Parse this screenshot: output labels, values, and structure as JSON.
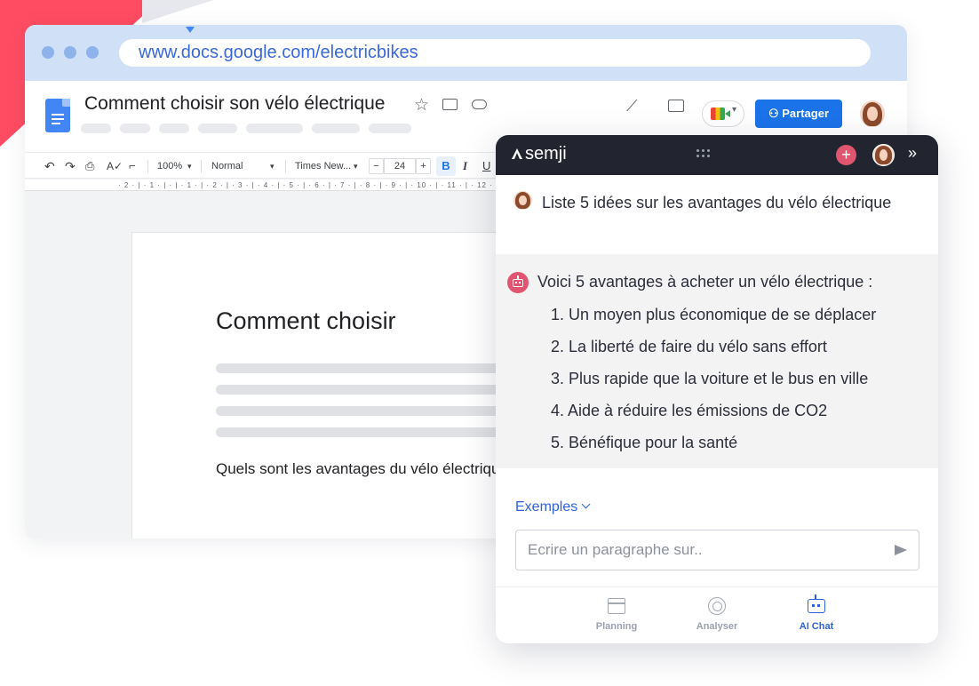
{
  "browser": {
    "url": "www.docs.google.com/electricbikes"
  },
  "docs": {
    "title": "Comment choisir son vélo électrique",
    "share_label": "Partager",
    "toolbar": {
      "zoom": "100%",
      "style": "Normal",
      "font": "Times New...",
      "font_size": "24",
      "bold": "B",
      "italic": "I",
      "underline": "U"
    },
    "ruler_text": "· 2 · | · 1 · |   · | · 1 · | · 2 · | · 3 · | · 4 · | · 5 · | · 6 · | · 7 · | · 8 · | · 9 · | · 10 · | · 11 · | · 12 · |",
    "page": {
      "heading": "Comment choisir",
      "question": "Quels sont les avantages du vélo électrique ?"
    }
  },
  "semji": {
    "brand": "semji",
    "user_message": "Liste 5 idées sur les avantages du vélo électrique",
    "bot_intro": "Voici 5 avantages à acheter un vélo électrique :",
    "bot_items": [
      "1. Un moyen plus économique de se déplacer",
      "2. La liberté de faire du vélo sans effort",
      "3. Plus rapide que la voiture et le bus en ville",
      "4. Aide à réduire les émissions de CO2",
      "5. Bénéfique pour la santé"
    ],
    "examples_label": "Exemples",
    "input_placeholder": "Ecrire un paragraphe sur..",
    "tabs": [
      {
        "label": "Planning",
        "icon": "calendar-icon",
        "active": false
      },
      {
        "label": "Analyser",
        "icon": "analyser-icon",
        "active": false
      },
      {
        "label": "AI Chat",
        "icon": "robot-icon",
        "active": true
      }
    ]
  },
  "colors": {
    "accent_blue": "#1a73e8",
    "semji_pink": "#e05570",
    "semji_dark": "#22252f",
    "deco_red": "#ff4c62"
  }
}
